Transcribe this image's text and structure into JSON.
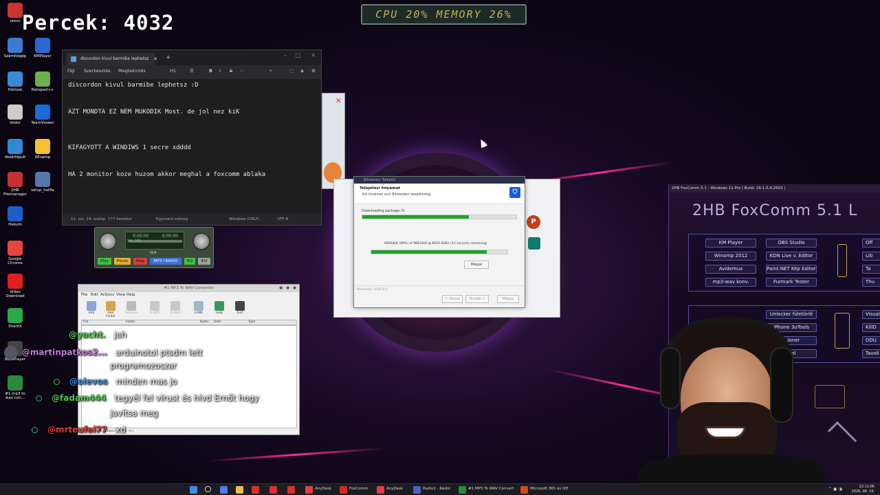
{
  "overlay": {
    "percek": "Percek: 4032",
    "cpu_memory": "CPU 20% MEMORY 26%"
  },
  "desktop_icons": [
    {
      "label": "olevo",
      "color": "#c33"
    },
    {
      "label": "Számítógép",
      "color": "#3a7bd5"
    },
    {
      "label": "KMPlayer",
      "color": "#2a6ad0"
    },
    {
      "label": "Hálózat",
      "color": "#3a8ad5"
    },
    {
      "label": "Notepad++",
      "color": "#6ab04c"
    },
    {
      "label": "Vodor",
      "color": "#ccc"
    },
    {
      "label": "TeamViewer",
      "color": "#1b6ad6"
    },
    {
      "label": "Vezérlőpult",
      "color": "#2f8ad6"
    },
    {
      "label": "Winamp",
      "color": "#f2c230"
    },
    {
      "label": "2HB Filemanager",
      "color": "#c43232"
    },
    {
      "label": "setup_hotfix",
      "color": "#5577aa"
    },
    {
      "label": "Hekum",
      "color": "#1e5ec8"
    },
    {
      "label": "Google Chrome",
      "color": "#e8453c"
    },
    {
      "label": "Video Download",
      "color": "#e02020"
    },
    {
      "label": "ShareX",
      "color": "#2ba84a"
    },
    {
      "label": "BossPlayer",
      "color": "#444"
    },
    {
      "label": "#1 mp3 to wav con...",
      "color": "#2a8a3a"
    }
  ],
  "notepad": {
    "tab_title": "discordon kivul barmibe lephetsz",
    "menu": [
      "Fájl",
      "Szerkesztés",
      "Megtekintés"
    ],
    "format_label": "H1",
    "lines": [
      "discordon kivul barmibe lephetsz :D",
      "AZT MONDTA EZ NEM MUKODIK Most. de jol nez kiK",
      "KIFAGYOTT A WINDIWS 1 secre xdddd",
      "HA 2 monitor koze huzom akkor meghal a foxcomm ablaka"
    ],
    "status": {
      "position": "11. sor, 14. oszlop",
      "chars": "177 karakter",
      "style": "Egyszerű szöveg",
      "line_ending": "Windows (CRLF)",
      "encoding": "UTF-8"
    }
  },
  "bitwarden": {
    "window_title": "Bitwarden Telepítő",
    "heading": "Telepítési folyamat",
    "subheading": "Kis türelmet a(z) Bitwarden telepítéséig.",
    "downloading_label": "Downloading package.7z",
    "progress_top": 0.69,
    "detail": "66608kB (69%) of 96814kB @ 8024.0kB/s (13 seconds remaining)",
    "progress_bottom": 0.85,
    "cancel_label": "Mégse",
    "footer": "Bitwarden 2024.8.2",
    "back_label": "< Vissza",
    "next_label": "Tovább >",
    "cancel2_label": "Mégse"
  },
  "mp3converter": {
    "title": "#1 MP3 To WAV Converter",
    "menu": [
      "File",
      "Edit",
      "Actions",
      "View",
      "Help"
    ],
    "tools": [
      "Add",
      "Add Folder",
      "Remove",
      "To MP3",
      "To WAV",
      "LAME",
      "Help",
      "Exit"
    ],
    "columns": [
      "File",
      "Folder",
      "Bytes",
      "Date",
      "Type"
    ],
    "status": "Current LAME options: -b 128 -m j"
  },
  "player": {
    "time_left": "0:00:00",
    "time_right": "0:00:00",
    "vol": "Vol.: 100",
    "track": "N/A",
    "buttons": [
      "Play",
      "Pause",
      "Stop",
      "MP3 / RADIO",
      "EQ",
      "ID3"
    ]
  },
  "chat": [
    {
      "user": "@yacht.",
      "message": "jah",
      "color": "#4ec94e",
      "badge": false
    },
    {
      "user": "@martinpatkos2...",
      "message": "arduinotol ptsdm lett",
      "color": "#c47bd8",
      "badge": false
    },
    {
      "user": "",
      "message": "programozoszar",
      "color": "#fff",
      "badge": false
    },
    {
      "user": "@olevos",
      "message": "minden mas jo",
      "color": "#3e8ee8",
      "badge": true
    },
    {
      "user": "@fadam444",
      "message": "tegyél fel vírust és hívd Ernőt hogy",
      "color": "#4ec94e",
      "badge": true
    },
    {
      "user": "",
      "message": "javítsa meg",
      "color": "#fff",
      "badge": false
    },
    {
      "user": "@mrteufel77",
      "message": "xd",
      "color": "#e03a3a",
      "badge": true
    }
  ],
  "foxcomm": {
    "title": "2HB FoxComm 5.1 - Windows 11 Pro | Build: 26.1.0.A.2603 |",
    "heading": "2HB FoxComm 5.1 L",
    "buttons_col1": [
      "KM Player",
      "Winamp 2012",
      "Avidemux",
      "mp3-wav konv."
    ],
    "buttons_col2": [
      "OBS Studio",
      "KDN Live v. Editor",
      "Paint.NET Kép Editor",
      "Furmark Tester"
    ],
    "buttons_col3": [
      "Off",
      "Lib",
      "Ta",
      "Thu"
    ],
    "buttons_row2_col2": [
      "Unlocker fületörlő",
      "iPhone 3uTools",
      "...ioner",
      "...ol"
    ],
    "buttons_row2_col3": [
      "Visual S",
      "KillD",
      "DDU",
      "Tavoli"
    ]
  },
  "taskbar": {
    "items": [
      {
        "label": "AnyDesk",
        "color": "#e04040"
      },
      {
        "label": "FoxComm",
        "color": "#d02828"
      },
      {
        "label": "AnyDesk",
        "color": "#e04040"
      },
      {
        "label": "Radio1 - Rádió",
        "color": "#5060c0"
      },
      {
        "label": "#1 MP3 To WAV Convert",
        "color": "#2a8a3a"
      },
      {
        "label": "Microsoft 365 és Off",
        "color": "#d04a20"
      }
    ],
    "time": "22:11:06",
    "date": "2026. 08. 19."
  }
}
